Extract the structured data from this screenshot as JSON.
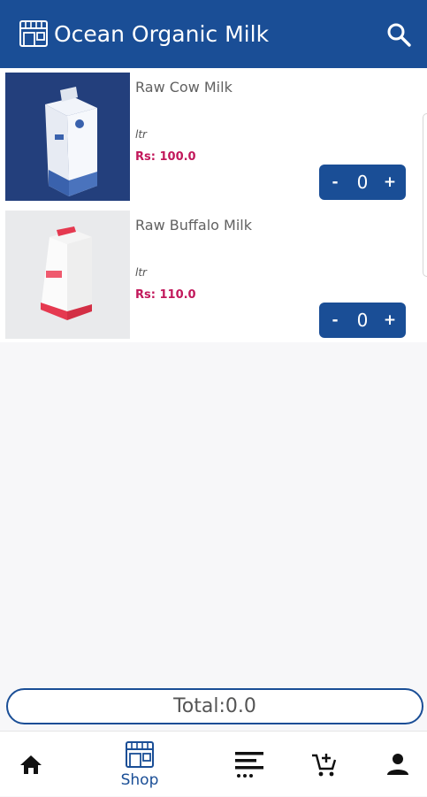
{
  "app": {
    "title": "Ocean Organic Milk",
    "accent_color": "#1a4e96",
    "price_color": "#c2185b"
  },
  "header": {
    "store_icon": "store-icon",
    "search_icon": "search-icon"
  },
  "products": [
    {
      "name": "Raw Cow Milk",
      "unit": "ltr",
      "price": "Rs: 100.0",
      "quantity": "0",
      "minus": "-",
      "plus": "+",
      "image": "milk-carton-blue"
    },
    {
      "name": "Raw Buffalo Milk",
      "unit": "ltr",
      "price": "Rs: 110.0",
      "quantity": "0",
      "minus": "-",
      "plus": "+",
      "image": "milk-carton-red"
    }
  ],
  "cart": {
    "total": "Total:0.0"
  },
  "nav": {
    "items": [
      {
        "icon": "home-icon",
        "label": ""
      },
      {
        "icon": "store-icon",
        "label": "Shop"
      },
      {
        "icon": "category-list-icon",
        "label": ""
      },
      {
        "icon": "add-to-cart-icon",
        "label": ""
      },
      {
        "icon": "person-icon",
        "label": ""
      }
    ]
  }
}
